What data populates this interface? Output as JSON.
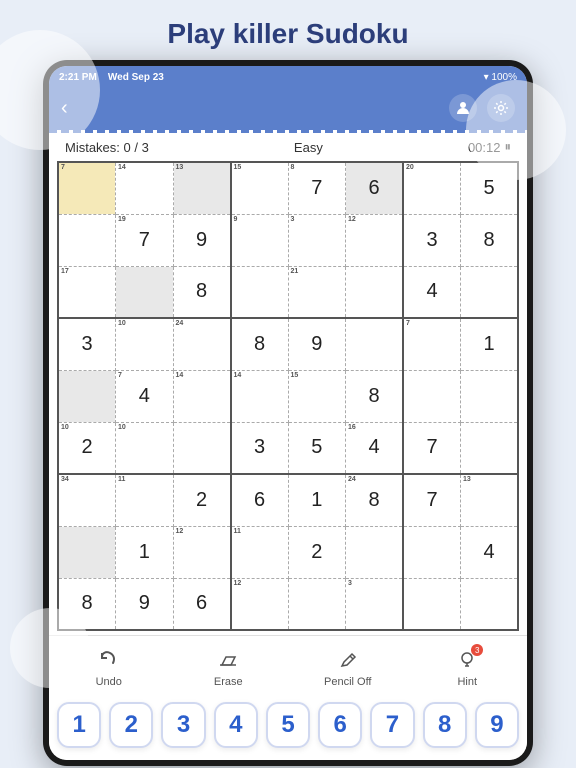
{
  "page": {
    "title": "Play killer Sudoku",
    "bg_circles": [
      {
        "class": "bg-circle-1"
      },
      {
        "class": "bg-circle-2"
      },
      {
        "class": "bg-circle-3"
      }
    ]
  },
  "status_bar": {
    "time": "2:21 PM",
    "date": "Wed Sep 23",
    "wifi": "WiFi",
    "battery": "100%"
  },
  "nav": {
    "back_icon": "‹",
    "profile_icon": "👤",
    "settings_icon": "⚙"
  },
  "game_info": {
    "mistakes_label": "Mistakes: 0 / 3",
    "difficulty": "Easy",
    "timer": "00:12",
    "pause_icon": "⏸"
  },
  "toolbar": {
    "items": [
      {
        "id": "undo",
        "label": "Undo",
        "icon": "↩"
      },
      {
        "id": "erase",
        "label": "Erase",
        "icon": "⌫"
      },
      {
        "id": "pencil",
        "label": "Pencil Off",
        "icon": "✏"
      },
      {
        "id": "hint",
        "label": "Hint",
        "icon": "💡",
        "badge": "3"
      }
    ]
  },
  "number_pad": {
    "numbers": [
      "1",
      "2",
      "3",
      "4",
      "5",
      "6",
      "7",
      "8",
      "9"
    ]
  },
  "grid": {
    "rows": [
      [
        {
          "val": "",
          "cage": "7",
          "hl": "yellow"
        },
        {
          "val": "",
          "cage": "14",
          "hl": ""
        },
        {
          "val": "",
          "cage": "13",
          "hl": "gray"
        },
        {
          "val": "",
          "cage": "15",
          "hl": ""
        },
        {
          "val": "7",
          "cage": "8",
          "hl": ""
        },
        {
          "val": "6",
          "cage": "",
          "hl": "gray"
        },
        {
          "val": "",
          "cage": "20",
          "hl": ""
        },
        {
          "val": "5",
          "cage": "",
          "hl": ""
        }
      ],
      [
        {
          "val": "",
          "cage": "",
          "hl": ""
        },
        {
          "val": "7",
          "cage": "19",
          "hl": ""
        },
        {
          "val": "9",
          "cage": "",
          "hl": ""
        },
        {
          "val": "",
          "cage": "9",
          "hl": ""
        },
        {
          "val": "",
          "cage": "3",
          "hl": ""
        },
        {
          "val": "",
          "cage": "12",
          "hl": ""
        },
        {
          "val": "3",
          "cage": "",
          "hl": ""
        },
        {
          "val": "8",
          "cage": "",
          "hl": ""
        }
      ],
      [
        {
          "val": "",
          "cage": "17",
          "hl": ""
        },
        {
          "val": "",
          "cage": "",
          "hl": "gray"
        },
        {
          "val": "8",
          "cage": "",
          "hl": ""
        },
        {
          "val": "",
          "cage": "",
          "hl": ""
        },
        {
          "val": "",
          "cage": "21",
          "hl": ""
        },
        {
          "val": "",
          "cage": "",
          "hl": ""
        },
        {
          "val": "4",
          "cage": "",
          "hl": ""
        },
        {
          "val": "",
          "cage": "",
          "hl": ""
        }
      ],
      [
        {
          "val": "3",
          "cage": "",
          "hl": ""
        },
        {
          "val": "",
          "cage": "10",
          "hl": ""
        },
        {
          "val": "",
          "cage": "24",
          "hl": ""
        },
        {
          "val": "8",
          "cage": "",
          "hl": ""
        },
        {
          "val": "9",
          "cage": "",
          "hl": ""
        },
        {
          "val": "",
          "cage": "",
          "hl": ""
        },
        {
          "val": "",
          "cage": "7",
          "hl": ""
        },
        {
          "val": "1",
          "cage": "",
          "hl": ""
        }
      ],
      [
        {
          "val": "",
          "cage": "",
          "hl": "gray"
        },
        {
          "val": "4",
          "cage": "7",
          "hl": ""
        },
        {
          "val": "",
          "cage": "14",
          "hl": ""
        },
        {
          "val": "",
          "cage": "14",
          "hl": ""
        },
        {
          "val": "",
          "cage": "15",
          "hl": ""
        },
        {
          "val": "8",
          "cage": "",
          "hl": ""
        },
        {
          "val": "",
          "cage": "",
          "hl": ""
        },
        {
          "val": "",
          "cage": "",
          "hl": ""
        }
      ],
      [
        {
          "val": "2",
          "cage": "10",
          "hl": ""
        },
        {
          "val": "",
          "cage": "10",
          "hl": ""
        },
        {
          "val": "",
          "cage": "",
          "hl": ""
        },
        {
          "val": "3",
          "cage": "",
          "hl": ""
        },
        {
          "val": "5",
          "cage": "",
          "hl": ""
        },
        {
          "val": "4",
          "cage": "16",
          "hl": ""
        },
        {
          "val": "7",
          "cage": "",
          "hl": ""
        },
        {
          "val": "",
          "cage": "",
          "hl": ""
        }
      ],
      [
        {
          "val": "",
          "cage": "34",
          "hl": ""
        },
        {
          "val": "",
          "cage": "11",
          "hl": ""
        },
        {
          "val": "2",
          "cage": "",
          "hl": ""
        },
        {
          "val": "6",
          "cage": "",
          "hl": ""
        },
        {
          "val": "1",
          "cage": "",
          "hl": ""
        },
        {
          "val": "8",
          "cage": "24",
          "hl": ""
        },
        {
          "val": "7",
          "cage": "",
          "hl": ""
        },
        {
          "val": "",
          "cage": "13",
          "hl": ""
        }
      ],
      [
        {
          "val": "",
          "cage": "",
          "hl": "gray"
        },
        {
          "val": "1",
          "cage": "",
          "hl": ""
        },
        {
          "val": "",
          "cage": "12",
          "hl": ""
        },
        {
          "val": "",
          "cage": "11",
          "hl": ""
        },
        {
          "val": "2",
          "cage": "",
          "hl": ""
        },
        {
          "val": "",
          "cage": "",
          "hl": ""
        },
        {
          "val": "",
          "cage": "",
          "hl": ""
        },
        {
          "val": "4",
          "cage": "",
          "hl": ""
        }
      ],
      [
        {
          "val": "8",
          "cage": "",
          "hl": ""
        },
        {
          "val": "9",
          "cage": "",
          "hl": ""
        },
        {
          "val": "6",
          "cage": "",
          "hl": ""
        },
        {
          "val": "",
          "cage": "12",
          "hl": ""
        },
        {
          "val": "",
          "cage": "",
          "hl": ""
        },
        {
          "val": "",
          "cage": "3",
          "hl": ""
        },
        {
          "val": "",
          "cage": "",
          "hl": ""
        },
        {
          "val": "",
          "cage": "",
          "hl": ""
        }
      ]
    ]
  }
}
